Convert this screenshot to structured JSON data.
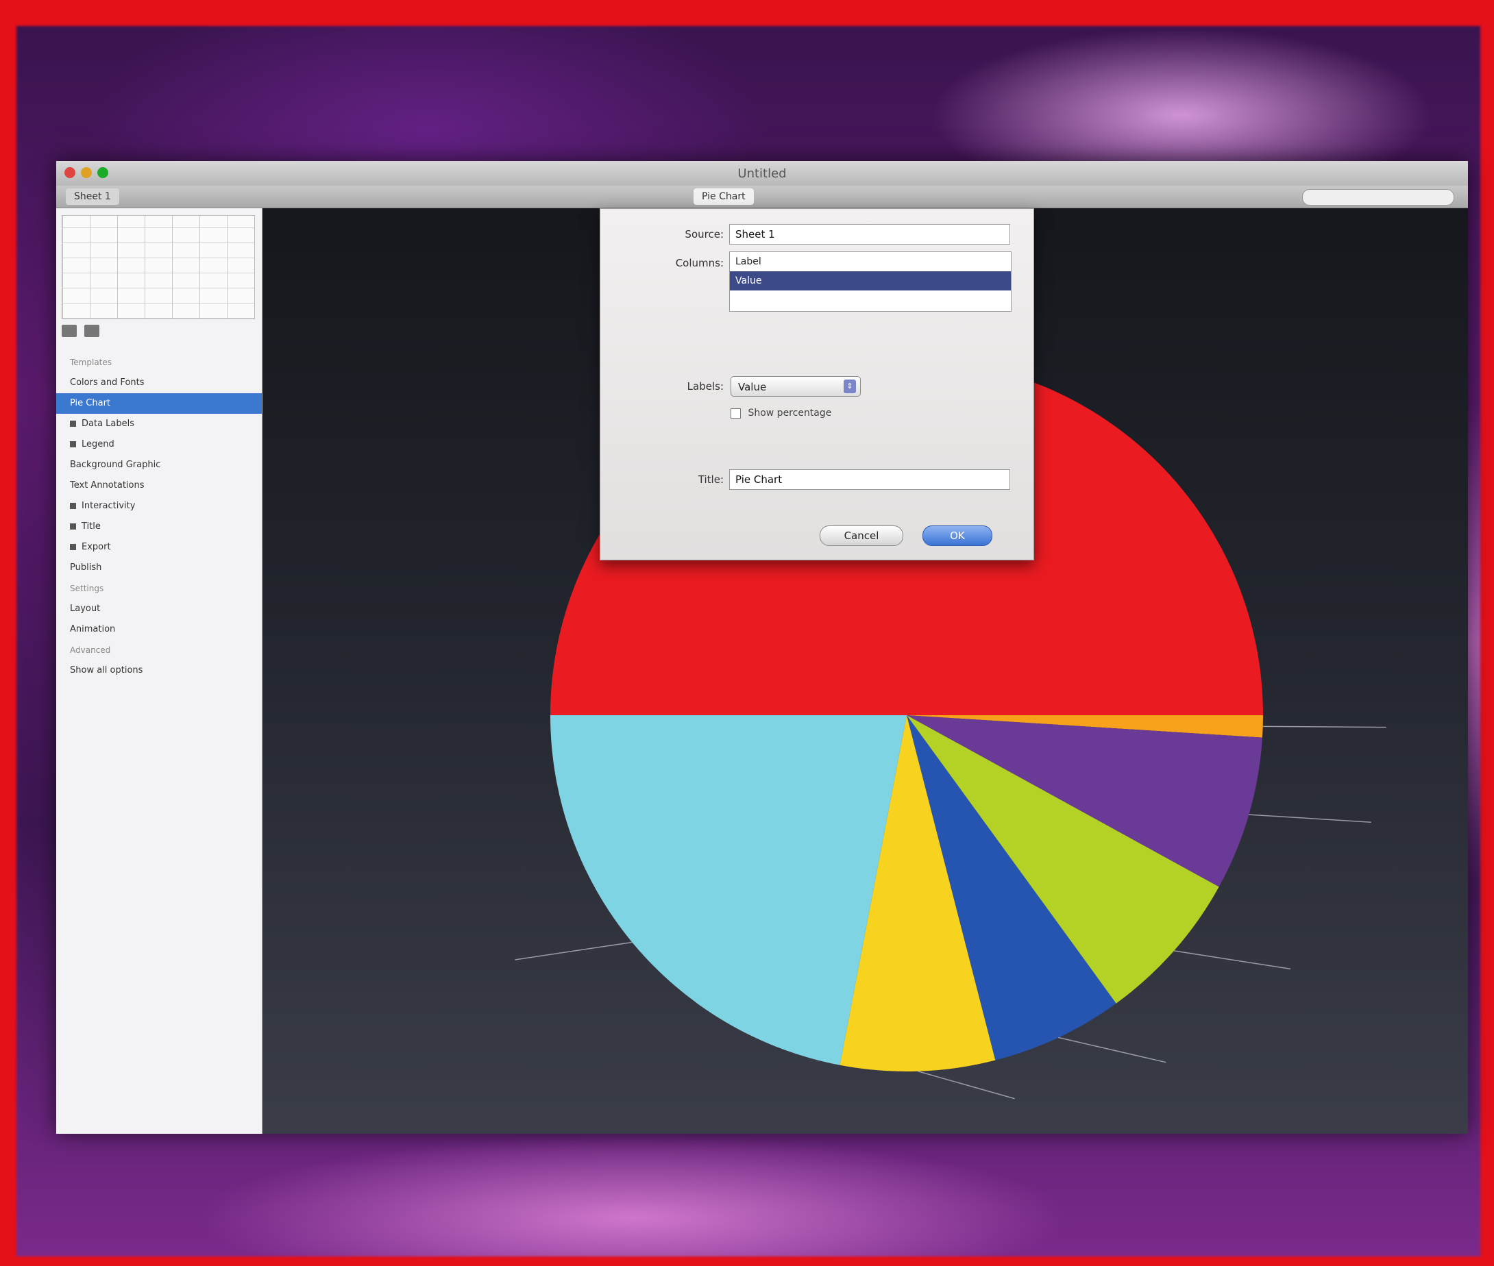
{
  "window": {
    "title": "Untitled",
    "tabs": [
      "Sheet 1",
      "Pie Chart"
    ],
    "active_tab": 1
  },
  "sidebar": {
    "items": [
      {
        "label": "Templates",
        "type": "section"
      },
      {
        "label": "Colors and Fonts",
        "type": "item"
      },
      {
        "label": "Pie Chart",
        "type": "item",
        "selected": true
      },
      {
        "label": "Data Labels",
        "type": "item",
        "icon": true
      },
      {
        "label": "Legend",
        "type": "item",
        "icon": true
      },
      {
        "label": "Background Graphic",
        "type": "item"
      },
      {
        "label": "Text Annotations",
        "type": "item"
      },
      {
        "label": "Interactivity",
        "type": "item",
        "icon": true
      },
      {
        "label": "Title",
        "type": "item",
        "icon": true
      },
      {
        "label": "Export",
        "type": "item",
        "icon": true
      },
      {
        "label": "Publish",
        "type": "item"
      },
      {
        "label": "Settings",
        "type": "section"
      },
      {
        "label": "Layout",
        "type": "item"
      },
      {
        "label": "Animation",
        "type": "item"
      },
      {
        "label": "Advanced",
        "type": "section"
      },
      {
        "label": "Show all options",
        "type": "item"
      }
    ]
  },
  "sheet": {
    "source_label": "Source:",
    "source_value": "Sheet 1",
    "columns_label": "Columns:",
    "list_rows": [
      "Label",
      "Value"
    ],
    "labels_label": "Labels:",
    "labels_value": "Value",
    "checkbox_label": "Show percentage",
    "name_label": "Title:",
    "name_value": "Pie Chart",
    "cancel_label": "Cancel",
    "ok_label": "OK"
  },
  "chart_data": {
    "type": "pie",
    "start_angle_deg": 0,
    "direction": "clockwise",
    "slices": [
      {
        "label": "",
        "value": 1,
        "color": "#f7a21a"
      },
      {
        "label": "",
        "value": 7,
        "color": "#6a3b96"
      },
      {
        "label": "",
        "value": 7,
        "color": "#b4d126"
      },
      {
        "label": "",
        "value": 6,
        "color": "#2555b0"
      },
      {
        "label": "",
        "value": 7,
        "color": "#f7d21e"
      },
      {
        "label": "",
        "value": 22,
        "color": "#7fd4e4"
      },
      {
        "label": "",
        "value": 50,
        "color": "#ea1b21"
      }
    ]
  }
}
